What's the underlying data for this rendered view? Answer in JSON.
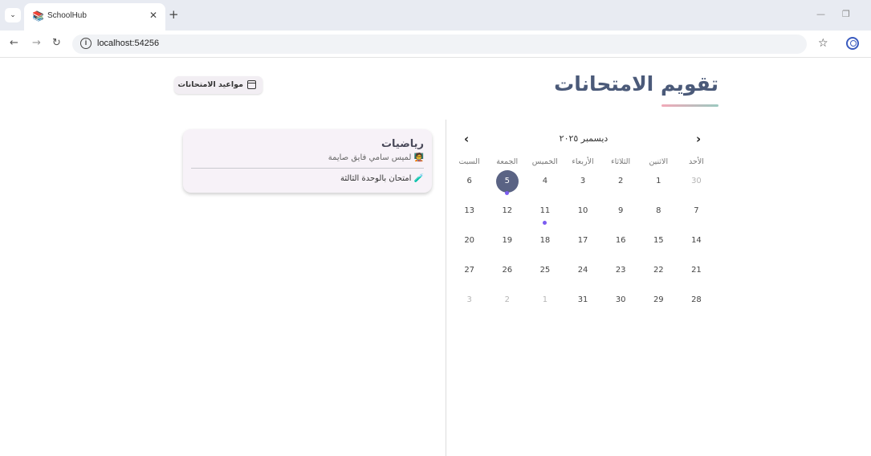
{
  "browser": {
    "tab_title": "SchoolHub",
    "tab_favicon": "📚",
    "new_tab_label": "+",
    "url": "localhost:54256"
  },
  "page": {
    "title": "تقويم الامتحانات",
    "schedule_button_label": "مواعيد الامتحانات"
  },
  "exam": {
    "subject": "رياضيات",
    "teacher": "🧑‍🏫 لميس سامي فايق صايمة",
    "title": "🧪 امتحان بالوحدة الثالثة"
  },
  "calendar": {
    "month_label": "ديسمبر ٢٠٢٥",
    "weekdays": [
      "الأحد",
      "الاثنين",
      "الثلاثاء",
      "الأربعاء",
      "الخميس",
      "الجمعة",
      "السبت"
    ],
    "weeks": [
      [
        {
          "d": "30",
          "muted": true
        },
        {
          "d": "1"
        },
        {
          "d": "2"
        },
        {
          "d": "3"
        },
        {
          "d": "4"
        },
        {
          "d": "5",
          "selected": true,
          "event": true
        },
        {
          "d": "6"
        }
      ],
      [
        {
          "d": "7"
        },
        {
          "d": "8"
        },
        {
          "d": "9"
        },
        {
          "d": "10"
        },
        {
          "d": "11",
          "event": true
        },
        {
          "d": "12"
        },
        {
          "d": "13"
        }
      ],
      [
        {
          "d": "14"
        },
        {
          "d": "15"
        },
        {
          "d": "16"
        },
        {
          "d": "17"
        },
        {
          "d": "18"
        },
        {
          "d": "19"
        },
        {
          "d": "20"
        }
      ],
      [
        {
          "d": "21"
        },
        {
          "d": "22"
        },
        {
          "d": "23"
        },
        {
          "d": "24"
        },
        {
          "d": "25"
        },
        {
          "d": "26"
        },
        {
          "d": "27"
        }
      ],
      [
        {
          "d": "28"
        },
        {
          "d": "29"
        },
        {
          "d": "30"
        },
        {
          "d": "31"
        },
        {
          "d": "1",
          "muted": true
        },
        {
          "d": "2",
          "muted": true
        },
        {
          "d": "3",
          "muted": true
        }
      ]
    ],
    "accent_color": "#5a6384",
    "event_dot_color": "#7b5cf0"
  }
}
